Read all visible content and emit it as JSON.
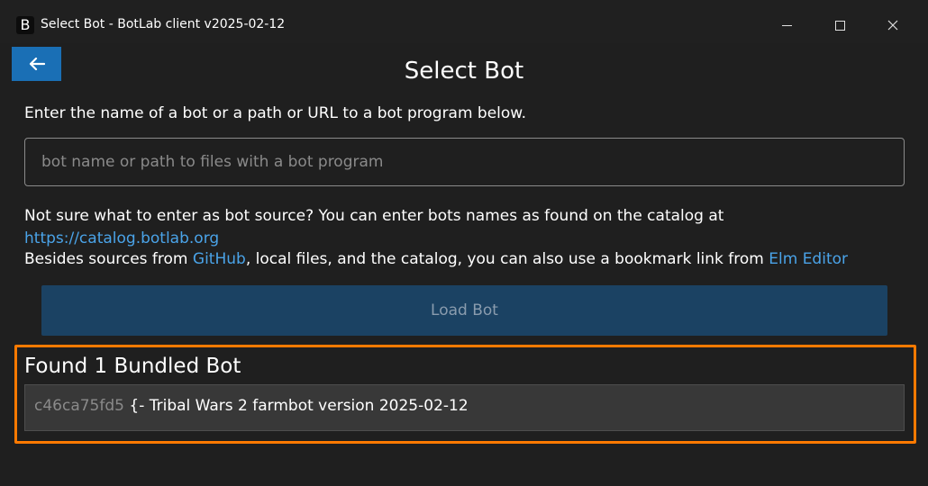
{
  "window": {
    "app_icon_letter": "B",
    "title": "Select Bot - BotLab client v2025-02-12"
  },
  "page": {
    "title": "Select Bot",
    "instructions": "Enter the name of a bot or a path or URL to a bot program below."
  },
  "source_input": {
    "value": "",
    "placeholder": "bot name or path to files with a bot program"
  },
  "hints": {
    "line1": "Not sure what to enter as bot source? You can enter bots names as found on the catalog at",
    "catalog_link": "https://catalog.botlab.org",
    "line2_prefix": "Besides sources from ",
    "github_link": "GitHub",
    "line2_middle": ", local files, and the catalog, you can also use a bookmark link from ",
    "elm_editor_link": "Elm Editor"
  },
  "load_button": {
    "label": "Load Bot"
  },
  "bundled": {
    "heading": "Found 1 Bundled Bot",
    "items": [
      {
        "hash": "c46ca75fd5",
        "description": "{- Tribal Wars 2 farmbot version 2025-02-12"
      }
    ]
  },
  "icons": {
    "back": "arrow-left-icon",
    "minimize": "minimize-icon",
    "maximize": "maximize-icon",
    "close": "close-icon"
  },
  "colors": {
    "accent": "#1a6fb5",
    "link": "#4aa3e8",
    "highlight": "#ff7a00",
    "load_button_bg": "#1b4263"
  }
}
